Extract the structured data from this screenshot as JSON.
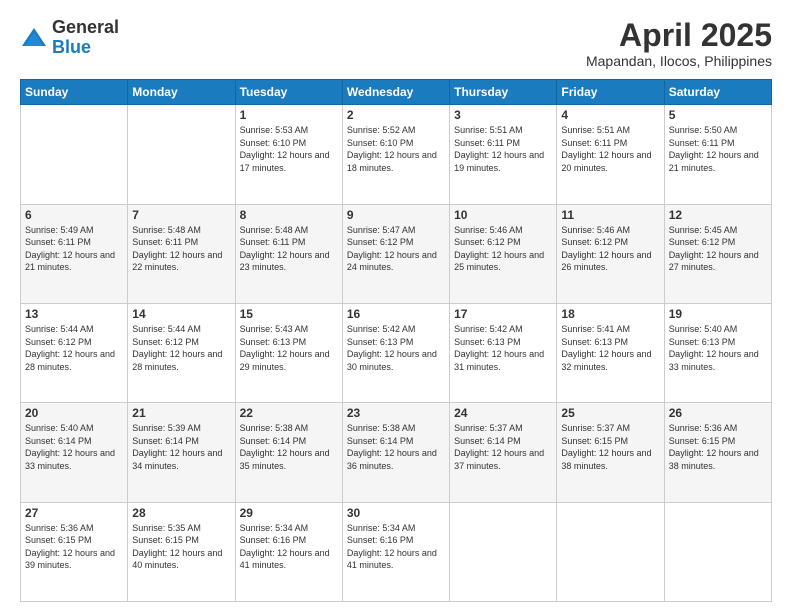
{
  "logo": {
    "general": "General",
    "blue": "Blue"
  },
  "title": {
    "month_year": "April 2025",
    "location": "Mapandan, Ilocos, Philippines"
  },
  "days_of_week": [
    "Sunday",
    "Monday",
    "Tuesday",
    "Wednesday",
    "Thursday",
    "Friday",
    "Saturday"
  ],
  "weeks": [
    [
      {
        "day": "",
        "info": ""
      },
      {
        "day": "",
        "info": ""
      },
      {
        "day": "1",
        "info": "Sunrise: 5:53 AM\nSunset: 6:10 PM\nDaylight: 12 hours and 17 minutes."
      },
      {
        "day": "2",
        "info": "Sunrise: 5:52 AM\nSunset: 6:10 PM\nDaylight: 12 hours and 18 minutes."
      },
      {
        "day": "3",
        "info": "Sunrise: 5:51 AM\nSunset: 6:11 PM\nDaylight: 12 hours and 19 minutes."
      },
      {
        "day": "4",
        "info": "Sunrise: 5:51 AM\nSunset: 6:11 PM\nDaylight: 12 hours and 20 minutes."
      },
      {
        "day": "5",
        "info": "Sunrise: 5:50 AM\nSunset: 6:11 PM\nDaylight: 12 hours and 21 minutes."
      }
    ],
    [
      {
        "day": "6",
        "info": "Sunrise: 5:49 AM\nSunset: 6:11 PM\nDaylight: 12 hours and 21 minutes."
      },
      {
        "day": "7",
        "info": "Sunrise: 5:48 AM\nSunset: 6:11 PM\nDaylight: 12 hours and 22 minutes."
      },
      {
        "day": "8",
        "info": "Sunrise: 5:48 AM\nSunset: 6:11 PM\nDaylight: 12 hours and 23 minutes."
      },
      {
        "day": "9",
        "info": "Sunrise: 5:47 AM\nSunset: 6:12 PM\nDaylight: 12 hours and 24 minutes."
      },
      {
        "day": "10",
        "info": "Sunrise: 5:46 AM\nSunset: 6:12 PM\nDaylight: 12 hours and 25 minutes."
      },
      {
        "day": "11",
        "info": "Sunrise: 5:46 AM\nSunset: 6:12 PM\nDaylight: 12 hours and 26 minutes."
      },
      {
        "day": "12",
        "info": "Sunrise: 5:45 AM\nSunset: 6:12 PM\nDaylight: 12 hours and 27 minutes."
      }
    ],
    [
      {
        "day": "13",
        "info": "Sunrise: 5:44 AM\nSunset: 6:12 PM\nDaylight: 12 hours and 28 minutes."
      },
      {
        "day": "14",
        "info": "Sunrise: 5:44 AM\nSunset: 6:12 PM\nDaylight: 12 hours and 28 minutes."
      },
      {
        "day": "15",
        "info": "Sunrise: 5:43 AM\nSunset: 6:13 PM\nDaylight: 12 hours and 29 minutes."
      },
      {
        "day": "16",
        "info": "Sunrise: 5:42 AM\nSunset: 6:13 PM\nDaylight: 12 hours and 30 minutes."
      },
      {
        "day": "17",
        "info": "Sunrise: 5:42 AM\nSunset: 6:13 PM\nDaylight: 12 hours and 31 minutes."
      },
      {
        "day": "18",
        "info": "Sunrise: 5:41 AM\nSunset: 6:13 PM\nDaylight: 12 hours and 32 minutes."
      },
      {
        "day": "19",
        "info": "Sunrise: 5:40 AM\nSunset: 6:13 PM\nDaylight: 12 hours and 33 minutes."
      }
    ],
    [
      {
        "day": "20",
        "info": "Sunrise: 5:40 AM\nSunset: 6:14 PM\nDaylight: 12 hours and 33 minutes."
      },
      {
        "day": "21",
        "info": "Sunrise: 5:39 AM\nSunset: 6:14 PM\nDaylight: 12 hours and 34 minutes."
      },
      {
        "day": "22",
        "info": "Sunrise: 5:38 AM\nSunset: 6:14 PM\nDaylight: 12 hours and 35 minutes."
      },
      {
        "day": "23",
        "info": "Sunrise: 5:38 AM\nSunset: 6:14 PM\nDaylight: 12 hours and 36 minutes."
      },
      {
        "day": "24",
        "info": "Sunrise: 5:37 AM\nSunset: 6:14 PM\nDaylight: 12 hours and 37 minutes."
      },
      {
        "day": "25",
        "info": "Sunrise: 5:37 AM\nSunset: 6:15 PM\nDaylight: 12 hours and 38 minutes."
      },
      {
        "day": "26",
        "info": "Sunrise: 5:36 AM\nSunset: 6:15 PM\nDaylight: 12 hours and 38 minutes."
      }
    ],
    [
      {
        "day": "27",
        "info": "Sunrise: 5:36 AM\nSunset: 6:15 PM\nDaylight: 12 hours and 39 minutes."
      },
      {
        "day": "28",
        "info": "Sunrise: 5:35 AM\nSunset: 6:15 PM\nDaylight: 12 hours and 40 minutes."
      },
      {
        "day": "29",
        "info": "Sunrise: 5:34 AM\nSunset: 6:16 PM\nDaylight: 12 hours and 41 minutes."
      },
      {
        "day": "30",
        "info": "Sunrise: 5:34 AM\nSunset: 6:16 PM\nDaylight: 12 hours and 41 minutes."
      },
      {
        "day": "",
        "info": ""
      },
      {
        "day": "",
        "info": ""
      },
      {
        "day": "",
        "info": ""
      }
    ]
  ]
}
